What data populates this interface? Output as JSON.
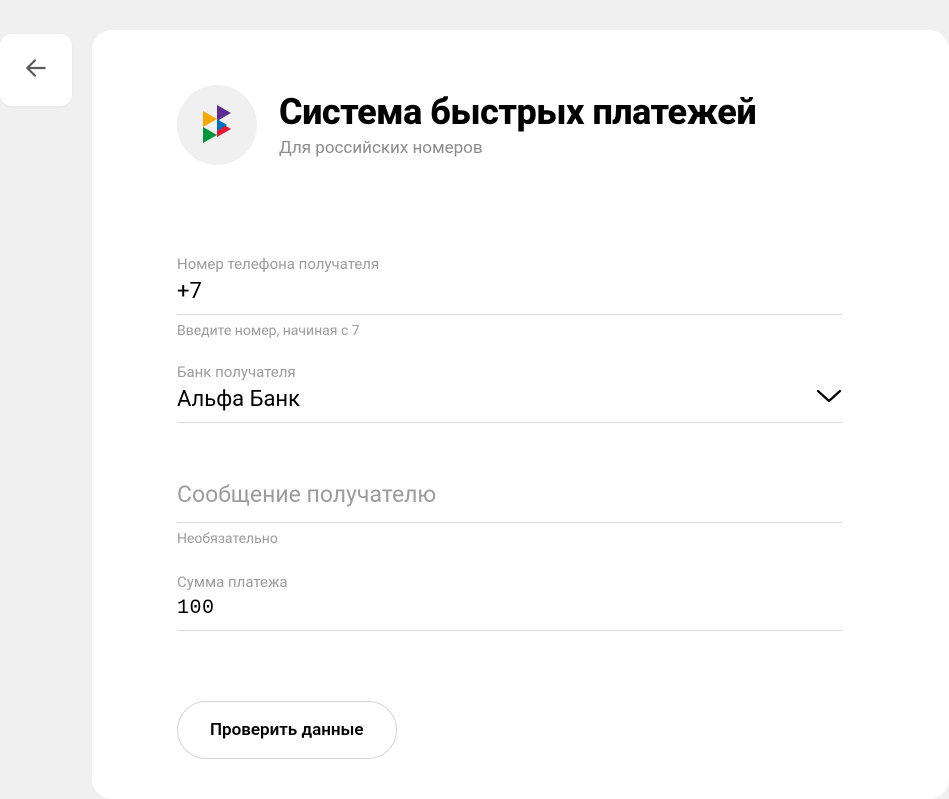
{
  "header": {
    "title": "Система быстрых платежей",
    "subtitle": "Для российских номеров"
  },
  "fields": {
    "phone": {
      "label": "Номер телефона получателя",
      "value": "+7",
      "hint": "Введите номер, начиная с 7"
    },
    "bank": {
      "label": "Банк получателя",
      "value": "Альфа Банк"
    },
    "message": {
      "placeholder": "Сообщение получателю",
      "hint": "Необязательно"
    },
    "amount": {
      "label": "Сумма платежа",
      "value": "100"
    }
  },
  "submit_label": "Проверить данные"
}
